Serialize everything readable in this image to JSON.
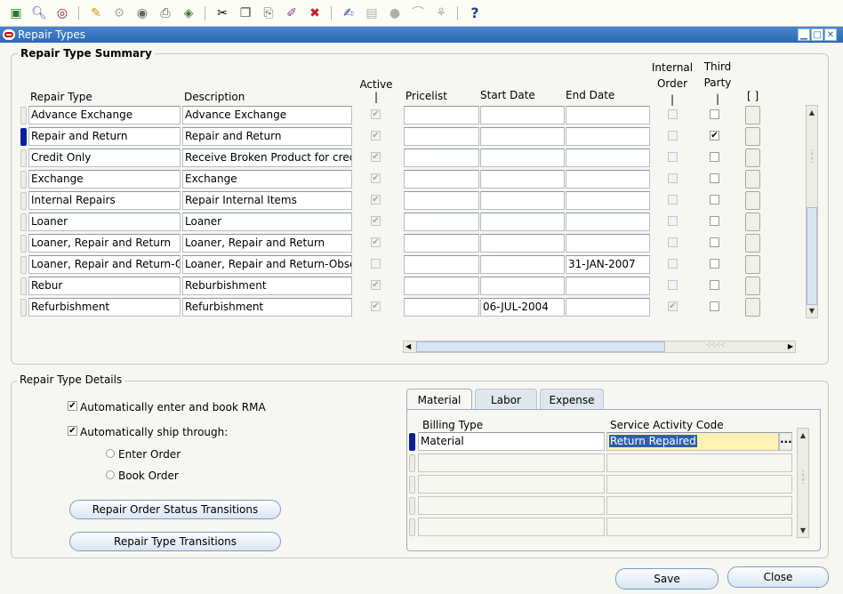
{
  "toolbar": {
    "icons": [
      "new-record-icon",
      "find-icon",
      "navigator-icon",
      "save-icon",
      "next-step-icon",
      "switch-responsibility-icon",
      "print-icon",
      "close-form-icon",
      "cut-icon",
      "copy-icon",
      "paste-icon",
      "clear-record-icon",
      "delete-record-icon",
      "edit-field-icon",
      "zoom-icon",
      "translations-icon",
      "attachments-icon",
      "folder-tools-icon",
      "help-icon"
    ]
  },
  "window": {
    "title": "Repair Types"
  },
  "summary": {
    "title": "Repair Type Summary",
    "headers": {
      "repair_type": "Repair Type",
      "description": "Description",
      "active": "Active",
      "active_bar": "|",
      "pricelist": "Pricelist",
      "start_date": "Start Date",
      "end_date": "End Date",
      "internal_order_1": "Internal",
      "internal_order_2": "Order",
      "internal_bar": "|",
      "third_party_1": "Third",
      "third_party_2": "Party",
      "third_bar": "|",
      "extra": "[ ]"
    },
    "rows": [
      {
        "repair_type": "Advance Exchange",
        "description": "Advance Exchange",
        "active": true,
        "pricelist": "",
        "start_date": "",
        "end_date": "",
        "internal_order": false,
        "third_party": false,
        "active_enabled": false
      },
      {
        "repair_type": "Repair and Return",
        "description": "Repair and Return",
        "active": true,
        "pricelist": "",
        "start_date": "",
        "end_date": "",
        "internal_order": false,
        "third_party": true,
        "active_enabled": false
      },
      {
        "repair_type": "Credit Only",
        "description": "Receive Broken Product for credit",
        "active": true,
        "pricelist": "",
        "start_date": "",
        "end_date": "",
        "internal_order": false,
        "third_party": false,
        "active_enabled": false
      },
      {
        "repair_type": "Exchange",
        "description": "Exchange",
        "active": true,
        "pricelist": "",
        "start_date": "",
        "end_date": "",
        "internal_order": false,
        "third_party": false,
        "active_enabled": false
      },
      {
        "repair_type": "Internal Repairs",
        "description": "Repair Internal Items",
        "active": true,
        "pricelist": "",
        "start_date": "",
        "end_date": "",
        "internal_order": false,
        "third_party": false,
        "active_enabled": false
      },
      {
        "repair_type": "Loaner",
        "description": "Loaner",
        "active": true,
        "pricelist": "",
        "start_date": "",
        "end_date": "",
        "internal_order": false,
        "third_party": false,
        "active_enabled": false
      },
      {
        "repair_type": "Loaner, Repair and Return",
        "description": "Loaner, Repair and Return",
        "active": true,
        "pricelist": "",
        "start_date": "",
        "end_date": "",
        "internal_order": false,
        "third_party": false,
        "active_enabled": false
      },
      {
        "repair_type": "Loaner, Repair and Return-Obsolete",
        "description": "Loaner, Repair and Return-Obsolete",
        "active": false,
        "pricelist": "",
        "start_date": "",
        "end_date": "31-JAN-2007",
        "internal_order": false,
        "third_party": false,
        "active_enabled": false
      },
      {
        "repair_type": "Rebur",
        "description": "Reburbishment",
        "active": true,
        "pricelist": "",
        "start_date": "",
        "end_date": "",
        "internal_order": false,
        "third_party": false,
        "active_enabled": false
      },
      {
        "repair_type": "Refurbishment",
        "description": "Refurbishment",
        "active": true,
        "pricelist": "",
        "start_date": "06-JUL-2004",
        "end_date": "",
        "internal_order": true,
        "third_party": false,
        "active_enabled": false
      }
    ],
    "current_row": 1
  },
  "details": {
    "title": "Repair Type Details",
    "auto_book_rma_label": "Automatically enter and book RMA",
    "auto_book_rma_checked": true,
    "auto_ship_label": "Automatically ship through:",
    "auto_ship_checked": true,
    "enter_order_label": "Enter Order",
    "book_order_label": "Book Order",
    "status_transitions_label": "Repair Order Status Transitions",
    "type_transitions_label": "Repair Type Transitions"
  },
  "tabs": {
    "items": [
      "Material",
      "Labor",
      "Expense"
    ],
    "active": 0,
    "billing_type_header": "Billing Type",
    "service_activity_header": "Service Activity Code",
    "rows": [
      {
        "billing_type": "Material",
        "service_activity": "Return Repaired"
      },
      {
        "billing_type": "",
        "service_activity": ""
      },
      {
        "billing_type": "",
        "service_activity": ""
      },
      {
        "billing_type": "",
        "service_activity": ""
      },
      {
        "billing_type": "",
        "service_activity": ""
      }
    ],
    "lov_button": "..."
  },
  "footer": {
    "save_label": "Save",
    "close_label": "Close"
  }
}
